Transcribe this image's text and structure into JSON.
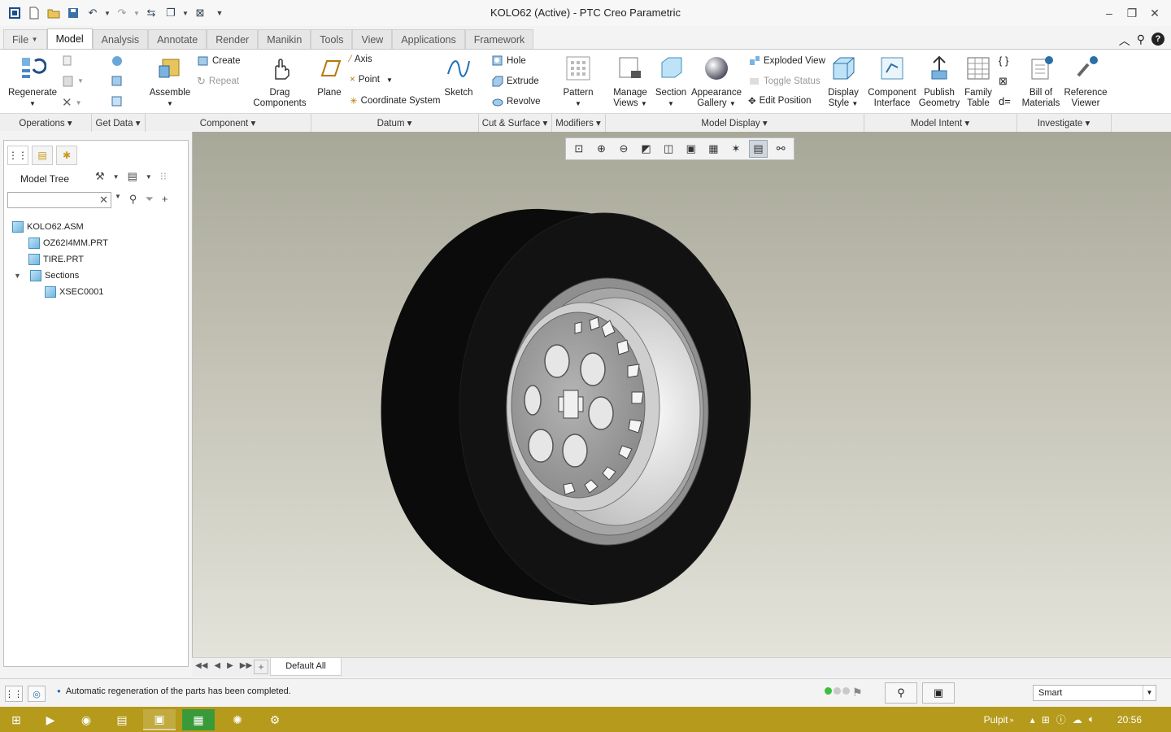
{
  "window": {
    "title": "KOLO62 (Active) - PTC Creo Parametric"
  },
  "tabs": [
    "File",
    "Model",
    "Analysis",
    "Annotate",
    "Render",
    "Manikin",
    "Tools",
    "View",
    "Applications",
    "Framework"
  ],
  "ribbon": {
    "regenerate": "Regenerate",
    "assemble": "Assemble",
    "create": "Create",
    "repeat": "Repeat",
    "drag_components": [
      "Drag",
      "Components"
    ],
    "plane": "Plane",
    "axis": "Axis",
    "point": "Point",
    "coordinate_system": "Coordinate System",
    "sketch": "Sketch",
    "hole": "Hole",
    "extrude": "Extrude",
    "revolve": "Revolve",
    "pattern": "Pattern",
    "manage_views": [
      "Manage",
      "Views"
    ],
    "section": "Section",
    "appearance_gallery": [
      "Appearance",
      "Gallery"
    ],
    "exploded_view": "Exploded View",
    "toggle_status": "Toggle Status",
    "edit_position": "Edit Position",
    "display_style": [
      "Display",
      "Style"
    ],
    "component_interface": [
      "Component",
      "Interface"
    ],
    "publish_geometry": [
      "Publish",
      "Geometry"
    ],
    "family_table": [
      "Family",
      "Table"
    ],
    "bill_of_materials": [
      "Bill of",
      "Materials"
    ],
    "reference_viewer": [
      "Reference",
      "Viewer"
    ]
  },
  "groups": [
    "Operations",
    "Get Data",
    "Component",
    "Datum",
    "Cut & Surface",
    "Modifiers",
    "Model Display",
    "Model Intent",
    "Investigate"
  ],
  "model_tree": {
    "title": "Model Tree",
    "items": [
      {
        "label": "KOLO62.ASM",
        "level": 0
      },
      {
        "label": "OZ62I4MM.PRT",
        "level": 1
      },
      {
        "label": "TIRE.PRT",
        "level": 1
      },
      {
        "label": "Sections",
        "level": 1,
        "expanded": true
      },
      {
        "label": "XSEC0001",
        "level": 2
      }
    ]
  },
  "bottom_tab": "Default All",
  "status": {
    "message": "Automatic regeneration of the parts has been completed.",
    "filter": "Smart"
  },
  "taskbar": {
    "lang": "Pulpit",
    "time": "20:56"
  },
  "colors": {
    "accent": "#1f5f9e",
    "taskbar": "#b59a1b",
    "tire": "#111111",
    "rim": "#9c9c9c"
  }
}
